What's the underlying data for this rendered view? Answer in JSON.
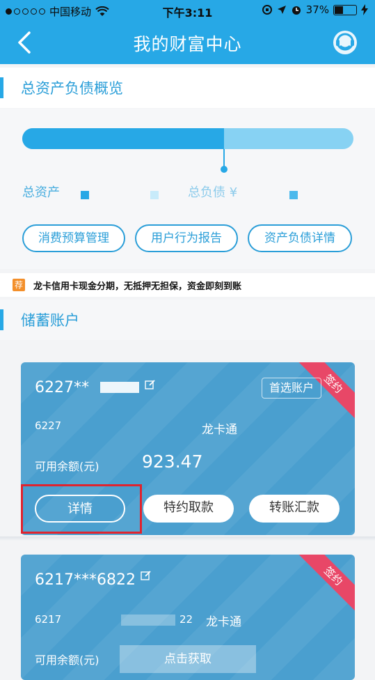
{
  "status_bar": {
    "carrier": "中国移动",
    "time": "下午3:11",
    "battery": "37%"
  },
  "nav": {
    "title": "我的财富中心",
    "back_icon": "chevron-left-icon",
    "service_icon": "customer-service-icon"
  },
  "overview": {
    "section_title": "总资产负债概览",
    "asset_ratio": 0.61,
    "assets_label": "总资产",
    "liabilities_label": "总负债 ¥",
    "buttons": [
      "消费预算管理",
      "用户行为报告",
      "资产负债详情"
    ],
    "colors": {
      "assets": "#27a8e6",
      "liabilities": "#87d2f3"
    }
  },
  "promo": {
    "tag": "荐",
    "text": "龙卡信用卡现金分期，无抵押无担保，资金即刻到账"
  },
  "savings": {
    "section_title": "储蓄账户",
    "cards": [
      {
        "number": "6227**",
        "sub_number": "6227",
        "card_type": "龙卡通",
        "ribbon": "签约",
        "preferred": "首选账户",
        "balance_label": "可用余额(元)",
        "balance": "923.47",
        "buttons": [
          "详情",
          "特约取款",
          "转账汇款"
        ]
      },
      {
        "number": "6217***6822",
        "sub_number": "6217",
        "sub_number_tail": "22",
        "card_type": "龙卡通",
        "ribbon": "签约",
        "balance_label": "可用余额(元)",
        "get_balance": "点击获取"
      }
    ]
  }
}
